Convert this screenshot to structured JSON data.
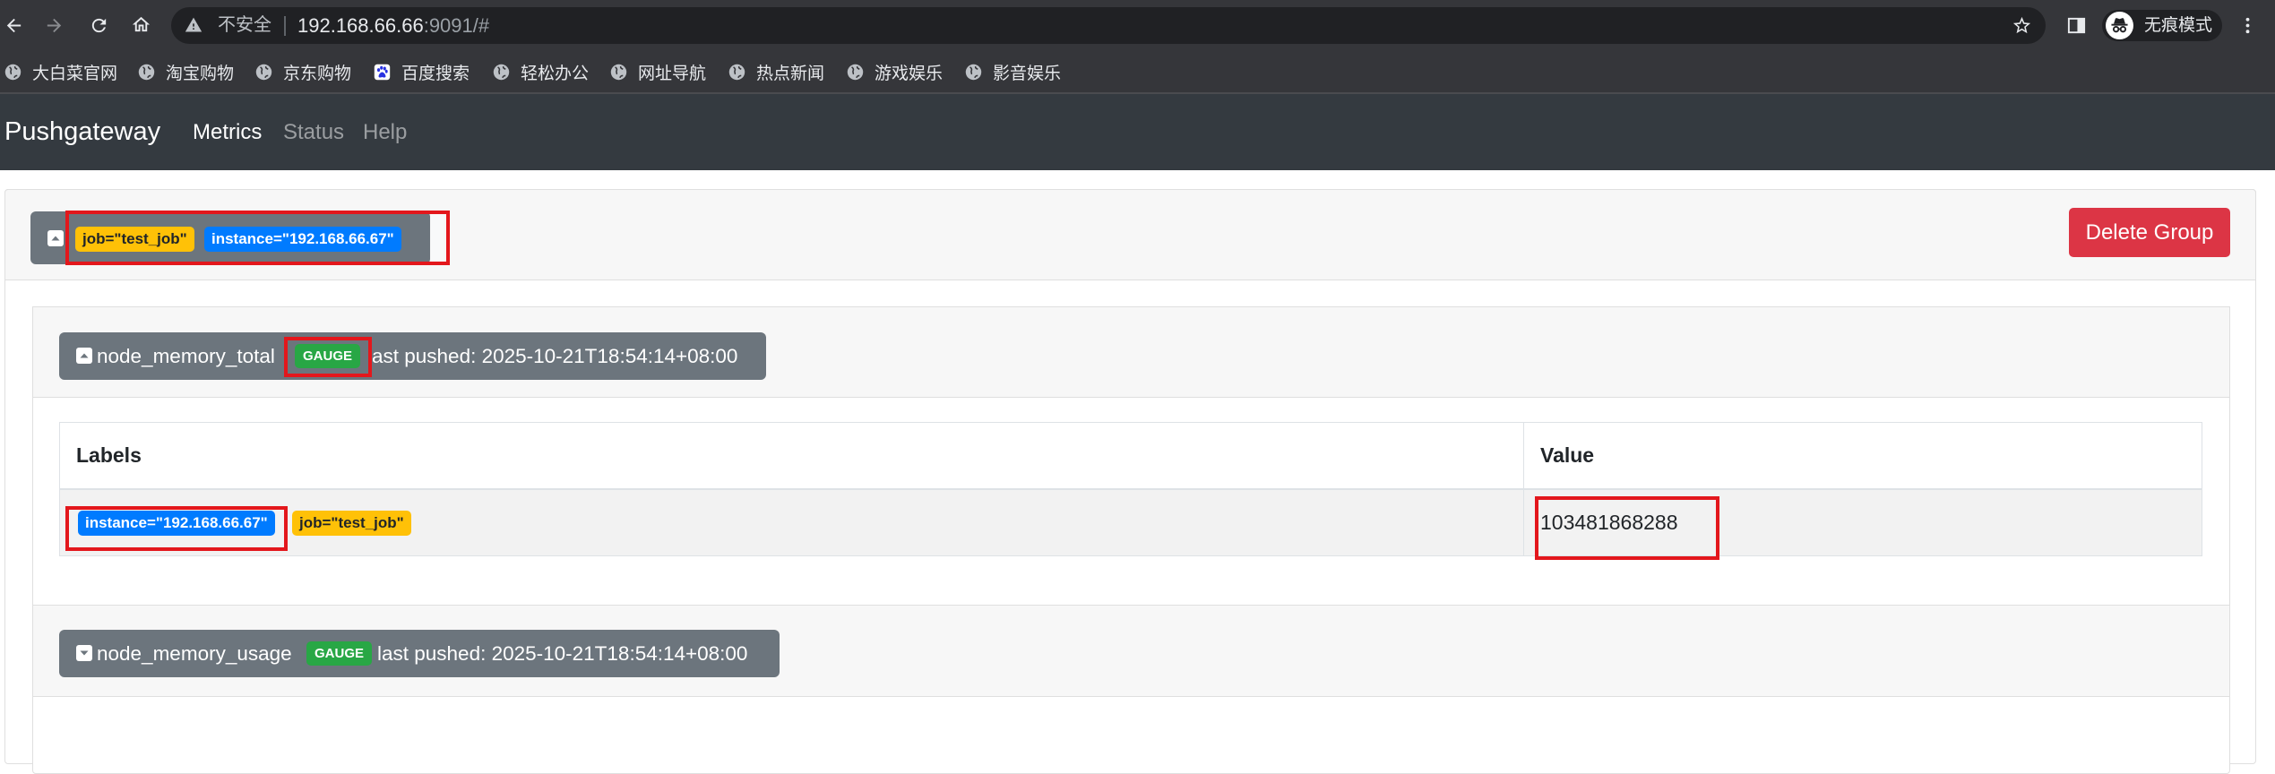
{
  "browser": {
    "security_label": "不安全",
    "url_host": "192.168.66.66",
    "url_rest": ":9091/#",
    "incognito_label": "无痕模式",
    "icons": [
      "back-icon",
      "forward-icon",
      "reload-icon",
      "home-icon",
      "not-secure-warning-icon",
      "bookmark-star-icon",
      "side-panel-icon",
      "incognito-icon",
      "more-menu-icon"
    ]
  },
  "bookmarks": [
    {
      "label": "大白菜官网",
      "icon": "globe-icon"
    },
    {
      "label": "淘宝购物",
      "icon": "globe-icon"
    },
    {
      "label": "京东购物",
      "icon": "globe-icon"
    },
    {
      "label": "百度搜索",
      "icon": "baidu-icon"
    },
    {
      "label": "轻松办公",
      "icon": "globe-icon"
    },
    {
      "label": "网址导航",
      "icon": "globe-icon"
    },
    {
      "label": "热点新闻",
      "icon": "globe-icon"
    },
    {
      "label": "游戏娱乐",
      "icon": "globe-icon"
    },
    {
      "label": "影音娱乐",
      "icon": "globe-icon"
    }
  ],
  "navbar": {
    "brand": "Pushgateway",
    "links": [
      {
        "label": "Metrics",
        "active": true
      },
      {
        "label": "Status",
        "active": false
      },
      {
        "label": "Help",
        "active": false
      }
    ]
  },
  "group": {
    "collapse_icon": "collapse-icon",
    "labels": [
      {
        "text": "job=\"test_job\"",
        "color": "#ffc107"
      },
      {
        "text": "instance=\"192.168.66.67\"",
        "color": "#007bff"
      }
    ],
    "delete_label": "Delete Group"
  },
  "metrics": [
    {
      "name": "node_memory_total",
      "type": "GAUGE",
      "last_pushed": "last pushed: 2025-10-21T18:54:14+08:00",
      "icon": "collapse-icon",
      "table": {
        "headers": [
          "Labels",
          "Value"
        ],
        "rows": [
          {
            "labels": [
              {
                "text": "instance=\"192.168.66.67\"",
                "color": "#007bff"
              },
              {
                "text": "job=\"test_job\"",
                "color": "#ffc107"
              }
            ],
            "value": "103481868288"
          }
        ]
      }
    },
    {
      "name": "node_memory_usage",
      "type": "GAUGE",
      "last_pushed": "last pushed: 2025-10-21T18:54:14+08:00",
      "icon": "expand-icon"
    }
  ],
  "colors": {
    "browser_toolbar": "#35363a",
    "omnibox": "#202124",
    "navbar": "#343a40",
    "secondary_button": "#6c757d",
    "danger_button": "#dc3545",
    "gauge_badge": "#28a745",
    "label_job": "#ffc107",
    "label_instance": "#007bff",
    "annotation_highlight": "#e3171c"
  }
}
